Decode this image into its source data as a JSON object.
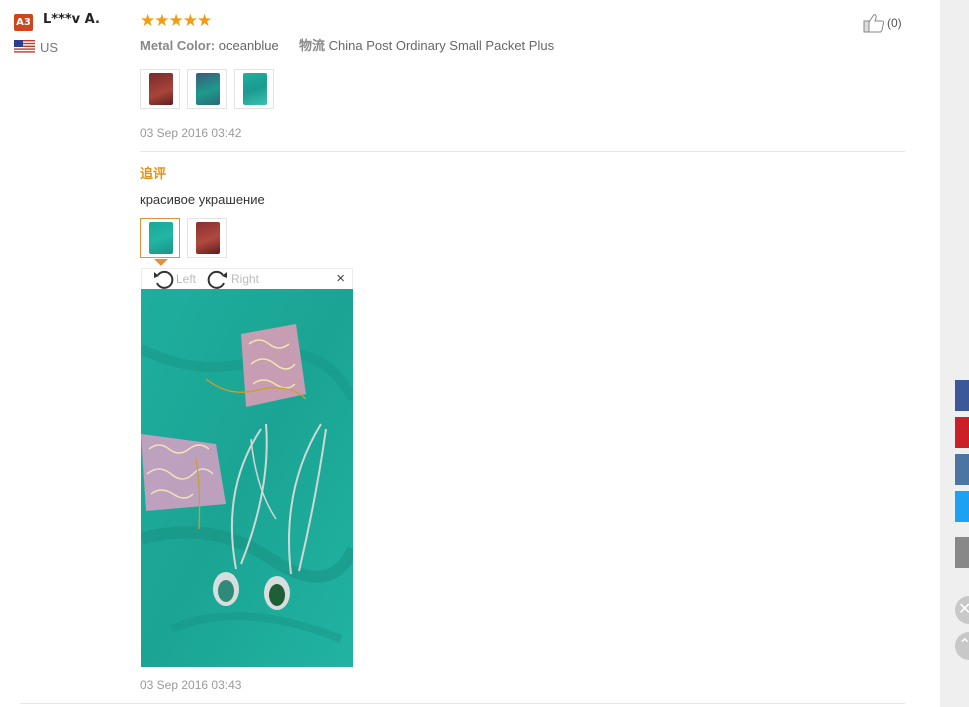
{
  "reviewer": {
    "badge": "A3",
    "name": "L***v A.",
    "country": "US"
  },
  "review": {
    "rating_stars": "★★★★★",
    "rating": 5,
    "attr_label": "Metal Color:",
    "attr_value": "oceanblue",
    "shipping_label": "物流",
    "shipping_value": "China Post Ordinary Small Packet Plus",
    "helpful_count": "(0)",
    "date": "03 Sep 2016 03:42"
  },
  "additional": {
    "label": "追评",
    "text": "красивое украшение",
    "date": "03 Sep 2016 03:43"
  },
  "viewer": {
    "rotate_left": "Left",
    "rotate_right": "Right",
    "close": "×"
  },
  "colors": {
    "accent": "#e49314",
    "badge": "#d0451b",
    "star": "#f39c12",
    "facebook": "#3b5998",
    "pinterest": "#cb2027",
    "vk": "#4c75a3",
    "twitter": "#1da1f2"
  },
  "icons": {
    "thumbs_up": "thumbs-up-icon",
    "rotate_left": "rotate-left-icon",
    "rotate_right": "rotate-right-icon",
    "close": "close-icon"
  }
}
